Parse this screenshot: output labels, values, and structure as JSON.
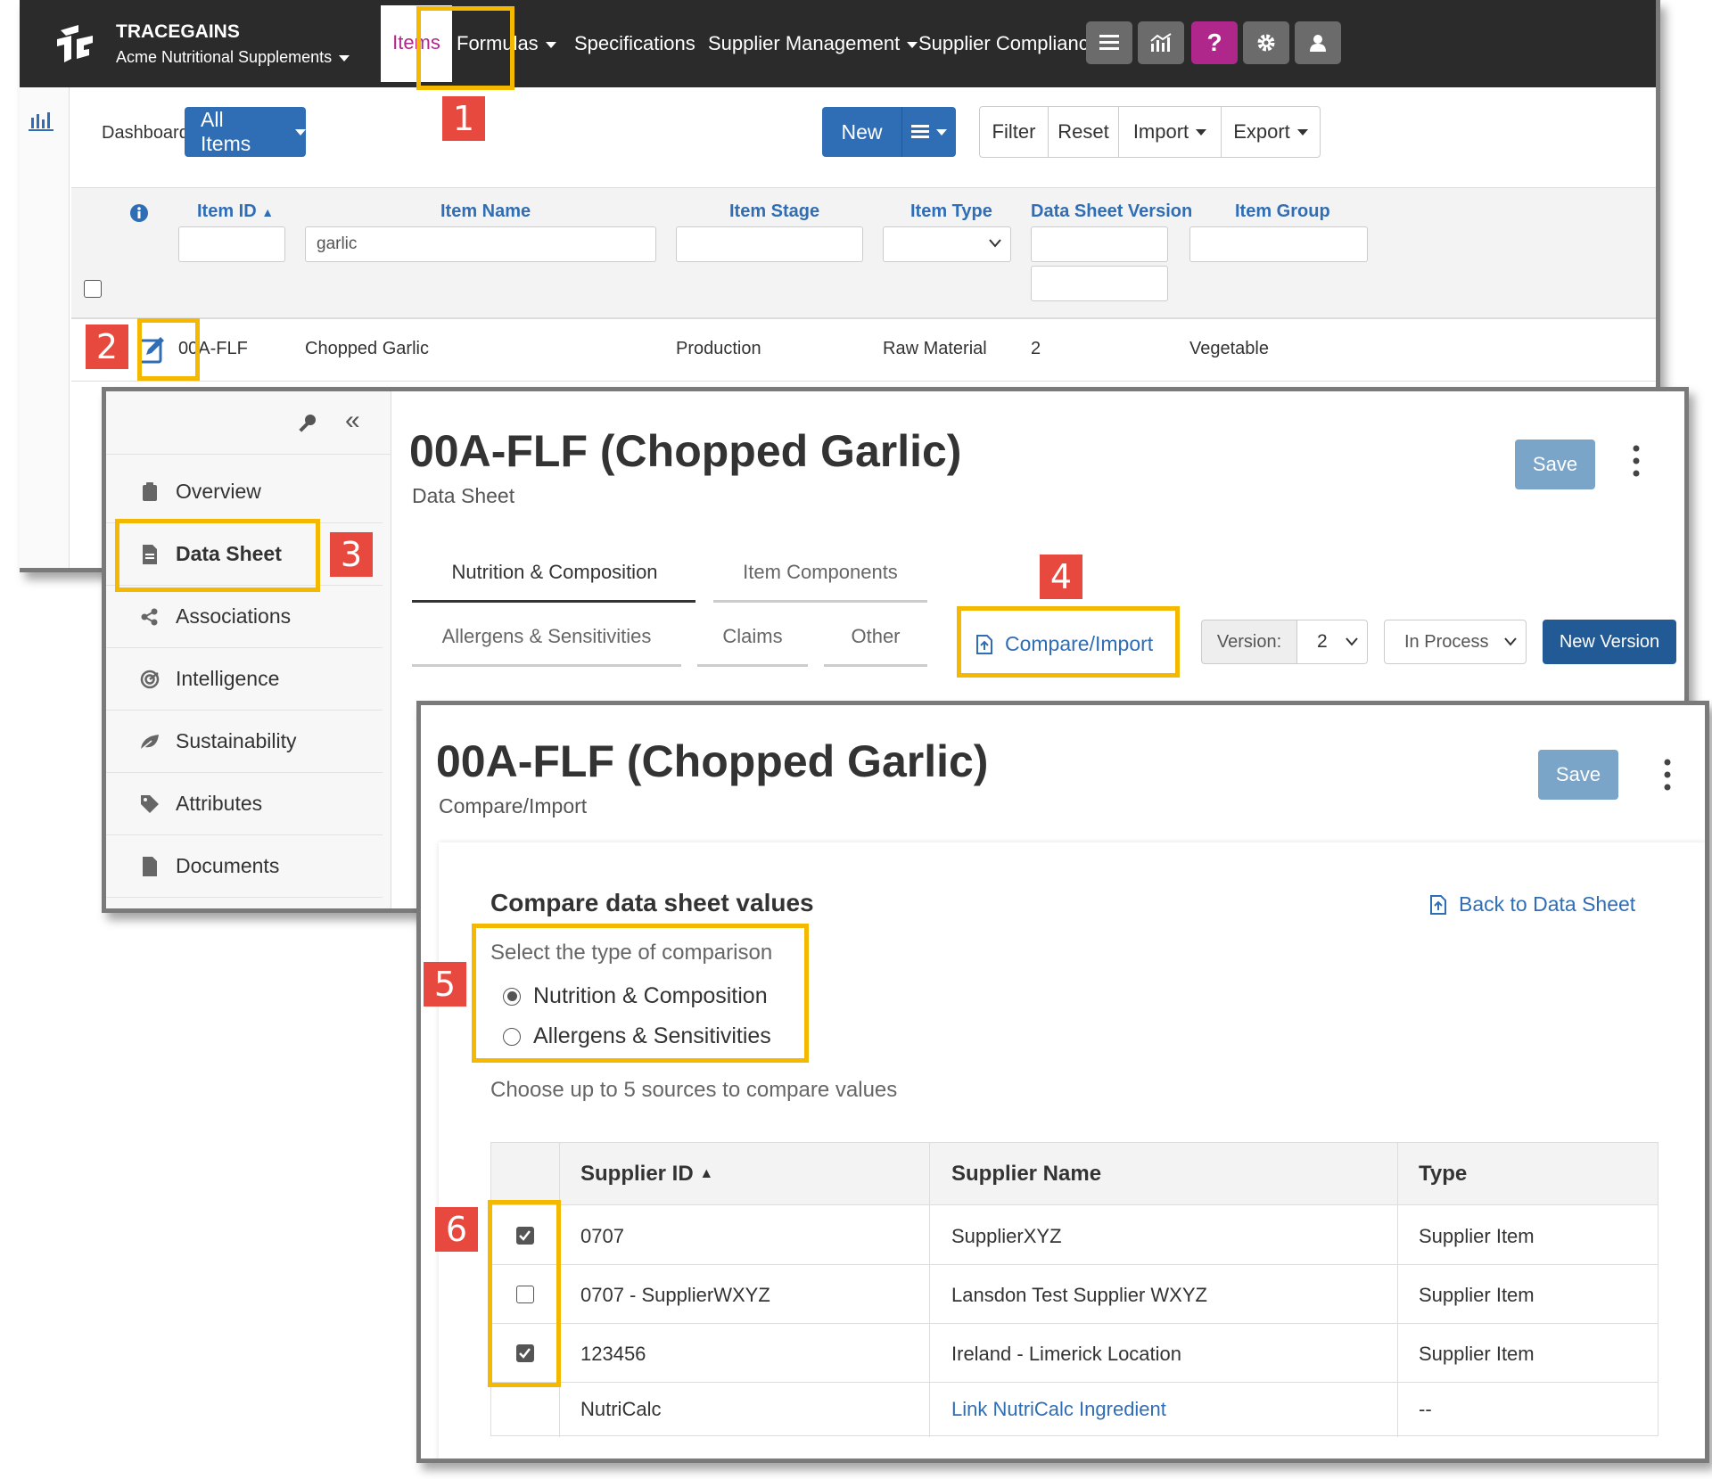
{
  "topnav": {
    "brand": "TRACEGAINS",
    "org": "Acme Nutritional Supplements",
    "items": [
      "Items",
      "Formulas",
      "Specifications",
      "Supplier Management",
      "Supplier Compliance"
    ],
    "icons": [
      "menu-icon",
      "analytics-icon",
      "help-icon",
      "gear-icon",
      "user-icon"
    ],
    "help_glyph": "?",
    "help_color": "#b0278c"
  },
  "toolbar": {
    "dashboard": "Dashboard",
    "view": "All Items",
    "new": "New",
    "filter": "Filter",
    "reset": "Reset",
    "import": "Import",
    "export": "Export"
  },
  "grid": {
    "columns": [
      "Item ID",
      "Item Name",
      "Item Stage",
      "Item Type",
      "Data Sheet Version",
      "Item Group"
    ],
    "sort_indicator": "▲",
    "filter_item_name": "garlic",
    "row": {
      "id": "00A-FLF",
      "name": "Chopped Garlic",
      "stage": "Production",
      "type": "Raw Material",
      "version": "2",
      "group": "Vegetable"
    }
  },
  "datasheet": {
    "title": "00A-FLF (Chopped Garlic)",
    "subtitle": "Data Sheet",
    "save": "Save",
    "sidebar": [
      "Overview",
      "Data Sheet",
      "Associations",
      "Intelligence",
      "Sustainability",
      "Attributes",
      "Documents"
    ],
    "tabs_row1": [
      "Nutrition & Composition",
      "Item Components"
    ],
    "tabs_row2": [
      "Allergens & Sensitivities",
      "Claims",
      "Other"
    ],
    "compare_import": "Compare/Import",
    "version_label": "Version:",
    "version_value": "2",
    "status": "In Process",
    "new_version": "New Version"
  },
  "compare": {
    "title": "00A-FLF (Chopped Garlic)",
    "subtitle": "Compare/Import",
    "save": "Save",
    "section_title": "Compare data sheet values",
    "back_link": "Back to Data Sheet",
    "type_prompt": "Select the type of comparison",
    "options": [
      "Nutrition & Composition",
      "Allergens & Sensitivities"
    ],
    "selected_option": "Nutrition & Composition",
    "sources_prompt": "Choose up to 5 sources to compare values",
    "table_headers": [
      "Supplier ID",
      "Supplier Name",
      "Type"
    ],
    "rows": [
      {
        "id": "0707",
        "name": "SupplierXYZ",
        "type": "Supplier Item",
        "checked": true
      },
      {
        "id": "0707 - SupplierWXYZ",
        "name": "Lansdon Test Supplier WXYZ",
        "type": "Supplier Item",
        "checked": false
      },
      {
        "id": "123456",
        "name": "Ireland - Limerick Location",
        "type": "Supplier Item",
        "checked": true
      },
      {
        "id": "NutriCalc",
        "name": "Link NutriCalc Ingredient",
        "type": "--",
        "checked": null
      }
    ]
  },
  "callouts": [
    "1",
    "2",
    "3",
    "4",
    "5",
    "6"
  ],
  "colors": {
    "nav": "#2b2b2b",
    "primary": "#2f6db5",
    "highlight": "#f5b800",
    "callout": "#e8493f",
    "save_disabled": "#7aa4c8",
    "new_version": "#215a94"
  }
}
